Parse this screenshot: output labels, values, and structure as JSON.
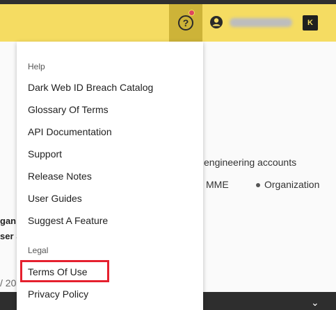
{
  "header": {
    "help_icon_glyph": "?",
    "brand_logo_text": "K",
    "accent_color": "#f5dc62",
    "notification_color": "#e0455f"
  },
  "background": {
    "engineering_text": "engineering accounts",
    "mme_text": "MME",
    "organization_text": "Organization",
    "partial_org_text": "ganiz",
    "partial_user_text": "ser S",
    "partial_date_text": "/ 20"
  },
  "menu": {
    "help_section": "Help",
    "help_items": [
      "Dark Web ID Breach Catalog",
      "Glossary Of Terms",
      "API Documentation",
      "Support",
      "Release Notes",
      "User Guides",
      "Suggest A Feature"
    ],
    "legal_section": "Legal",
    "legal_items": [
      "Terms Of Use",
      "Privacy Policy"
    ]
  }
}
